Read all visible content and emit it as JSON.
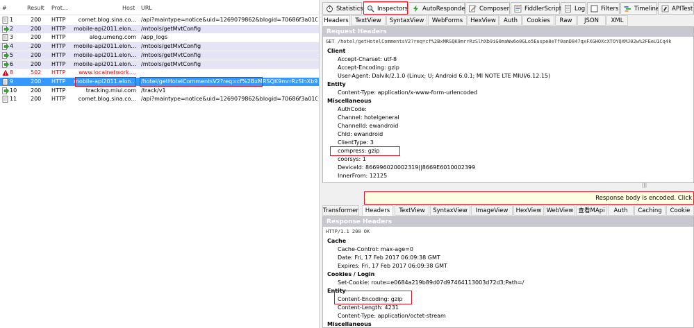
{
  "sessions": {
    "headers": {
      "num": "#",
      "result": "Result",
      "protocol": "Prot...",
      "host": "Host",
      "url": "URL"
    },
    "rows": [
      {
        "icon": "page-icon",
        "num": "1",
        "result": "200",
        "protocol": "HTTP",
        "host": "comet.blog.sina.co...",
        "url": "/api?maintype=notice&uid=1269079862&blogid=70686f3a0101ke...",
        "style": "normal"
      },
      {
        "icon": "arrow-icon",
        "num": "2",
        "result": "200",
        "protocol": "HTTP",
        "host": "mobile-api2011.elon...",
        "url": "/mtools/getMvtConfig",
        "style": "alt"
      },
      {
        "icon": "page-icon",
        "num": "3",
        "result": "200",
        "protocol": "HTTP",
        "host": "alog.umeng.com",
        "url": "/app_logs",
        "style": "normal"
      },
      {
        "icon": "arrow-icon",
        "num": "4",
        "result": "200",
        "protocol": "HTTP",
        "host": "mobile-api2011.elon...",
        "url": "/mtools/getMvtConfig",
        "style": "alt"
      },
      {
        "icon": "arrow-icon",
        "num": "5",
        "result": "200",
        "protocol": "HTTP",
        "host": "mobile-api2011.elon...",
        "url": "/mtools/getMvtConfig",
        "style": "alt"
      },
      {
        "icon": "arrow-icon",
        "num": "6",
        "result": "200",
        "protocol": "HTTP",
        "host": "mobile-api2011.elon...",
        "url": "/mtools/getMvtConfig",
        "style": "alt"
      },
      {
        "icon": "warning-icon",
        "num": "8",
        "result": "502",
        "protocol": "HTTP",
        "host": "www.localnetwork....",
        "url": "",
        "style": "err"
      },
      {
        "icon": "page-icon",
        "num": "9",
        "result": "200",
        "protocol": "HTTP",
        "host": "mobile-api2011.elon...",
        "url": "/hotel/getHotelCommentsV2?req=cf%2BxMRSQK9mrrRzSlhXb9iG0...",
        "style": "sel"
      },
      {
        "icon": "arrow-icon",
        "num": "10",
        "result": "200",
        "protocol": "HTTP",
        "host": "tracking.miui.com",
        "url": "/track/v1",
        "style": "normal"
      },
      {
        "icon": "page-icon",
        "num": "11",
        "result": "200",
        "protocol": "HTTP",
        "host": "comet.blog.sina.co...",
        "url": "/api?maintype=notice&uid=1269079862&blogid=70686f3a0101ke...",
        "style": "normal"
      }
    ]
  },
  "toptabs": [
    {
      "label": "Statistics",
      "icon": "stopwatch-icon",
      "active": false
    },
    {
      "label": "Inspectors",
      "icon": "magnifier-icon",
      "active": true
    },
    {
      "label": "AutoResponder",
      "icon": "lightning-icon",
      "active": false
    },
    {
      "label": "Composer",
      "icon": "pencil-icon",
      "active": false
    },
    {
      "label": "FiddlerScript",
      "icon": "script-icon",
      "active": false
    },
    {
      "label": "Log",
      "icon": "log-icon",
      "active": false
    },
    {
      "label": "Filters",
      "icon": "checkbox-icon",
      "active": false
    },
    {
      "label": "Timeline",
      "icon": "timeline-icon",
      "active": false
    },
    {
      "label": "APITest",
      "icon": "api-icon",
      "active": false
    }
  ],
  "request_tabs": [
    "Headers",
    "TextView",
    "SyntaxView",
    "WebForms",
    "HexView",
    "Auth",
    "Cookies",
    "Raw",
    "JSON",
    "XML"
  ],
  "request": {
    "title": "Request Headers",
    "line": "GET /hotel/getHotelCommentsV2?req=cf%2BxMRSQK9mrrRzSlhXb9iG0maWw6o0GLo5Euspe8eTf0anD847qxFXGHOXcXTOYQXMJ02w%2FEeU1Cq4k",
    "groups": [
      {
        "name": "Client",
        "items": [
          "Accept-Charset: utf-8",
          "Accept-Encoding: gzip",
          "User-Agent: Dalvik/2.1.0 (Linux; U; Android 6.0.1; MI NOTE LTE MIUI/6.12.15)"
        ]
      },
      {
        "name": "Entity",
        "items": [
          "Content-Type: application/x-www-form-urlencoded"
        ]
      },
      {
        "name": "Miscellaneous",
        "items": [
          "AuthCode:",
          "Channel: hotelgeneral",
          "ChannelId: ewandroid",
          "ChId: ewandroid",
          "ClientType: 3",
          "compress: gzip",
          "coorsys: 1",
          "DeviceId: 866996020002319||8669E6010002399",
          "InnerFrom: 12125"
        ]
      }
    ]
  },
  "splitter_glyph": "|||",
  "encoded_notice": "Response body is encoded. Click",
  "response_tabs": [
    "Transformer",
    "Headers",
    "TextView",
    "SyntaxView",
    "ImageView",
    "HexView",
    "WebView",
    "查看MApi",
    "Auth",
    "Caching",
    "Cookie"
  ],
  "response": {
    "title": "Response Headers",
    "line": "HTTP/1.1 200 OK",
    "groups": [
      {
        "name": "Cache",
        "items": [
          "Cache-Control: max-age=0",
          "Date: Fri, 17 Feb 2017 06:09:38 GMT",
          "Expires: Fri, 17 Feb 2017 06:09:38 GMT"
        ]
      },
      {
        "name": "Cookies / Login",
        "items": [
          "Set-Cookie: route=e0684a219b89d07d97464113003d72d3;Path=/"
        ]
      },
      {
        "name": "Entity",
        "items": [
          "Content-Encoding: gzip",
          "Content-Length: 4231",
          "Content-Type: application/octet-stream"
        ]
      },
      {
        "name": "Miscellaneous",
        "items": []
      }
    ]
  },
  "colors": {
    "selected_row": "#3399ff",
    "alt_row": "#e4e4f6",
    "error_text": "#e00000",
    "highlight_box": "#e81123",
    "section_header": "#c8c8d0",
    "notice_bg": "#ffffe1"
  }
}
